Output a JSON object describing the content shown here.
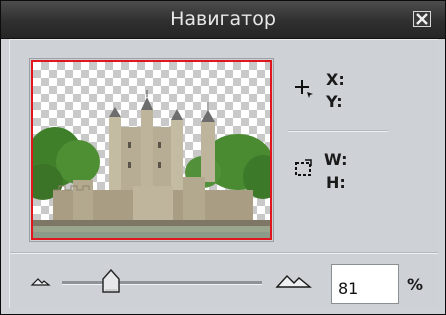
{
  "window": {
    "title": "Навигатор",
    "close_icon": "close-x-icon"
  },
  "preview": {
    "image": "thumbnail of castle (Tower of London) on transparent canvas",
    "viewport_color": "#e0161d"
  },
  "info": {
    "x_label": "X:",
    "y_label": "Y:",
    "w_label": "W:",
    "h_label": "H:",
    "cursor_icon": "crosshair-icon",
    "selection_icon": "selection-size-icon"
  },
  "zoom": {
    "value": "81",
    "unit": "%",
    "zoom_out_icon": "mountain-small-icon",
    "zoom_in_icon": "mountain-large-icon"
  }
}
